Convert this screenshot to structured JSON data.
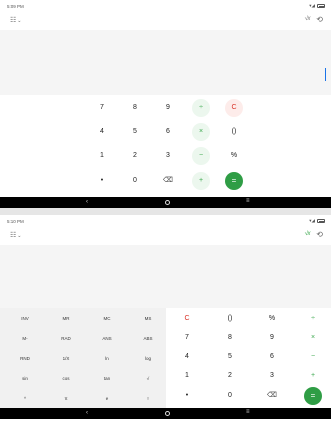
{
  "top": {
    "status": {
      "time": "5:09 PM",
      "signal": "▾◢"
    },
    "toolbar": {
      "mode": "☷",
      "sci": "√x",
      "history": "⟲"
    },
    "keys": {
      "row1": [
        "7",
        "8",
        "9",
        "÷",
        "C"
      ],
      "row2": [
        "4",
        "5",
        "6",
        "×",
        "()"
      ],
      "row3": [
        "1",
        "2",
        "3",
        "−",
        "%"
      ],
      "row4": [
        "•",
        "0",
        "⌫",
        "+",
        "="
      ]
    }
  },
  "bottom": {
    "status": {
      "time": "5:10 PM",
      "signal": "▾◢"
    },
    "toolbar": {
      "mode": "☷",
      "sci": "√x",
      "history": "⟲"
    },
    "sci_keys": {
      "row1": [
        "INV",
        "MR",
        "MC",
        "MS"
      ],
      "row2": [
        "M-",
        "RAD",
        "ANS",
        "ABS"
      ],
      "row3": [
        "RND",
        "1/X",
        "ln",
        "log"
      ],
      "row4": [
        "sin",
        "cos",
        "tan",
        "√"
      ],
      "row5": [
        "^",
        "π",
        "e",
        "!"
      ]
    },
    "keys": {
      "row1": [
        "C",
        "()",
        "%",
        "÷"
      ],
      "row2": [
        "7",
        "8",
        "9",
        "×"
      ],
      "row3": [
        "4",
        "5",
        "6",
        "−"
      ],
      "row4": [
        "1",
        "2",
        "3",
        "+"
      ],
      "row5": [
        "•",
        "0",
        "⌫",
        "="
      ]
    }
  },
  "nav": {
    "back": "‹",
    "recent": "≡"
  },
  "colors": {
    "accent": "#2f9d45",
    "clear": "#d93025"
  }
}
